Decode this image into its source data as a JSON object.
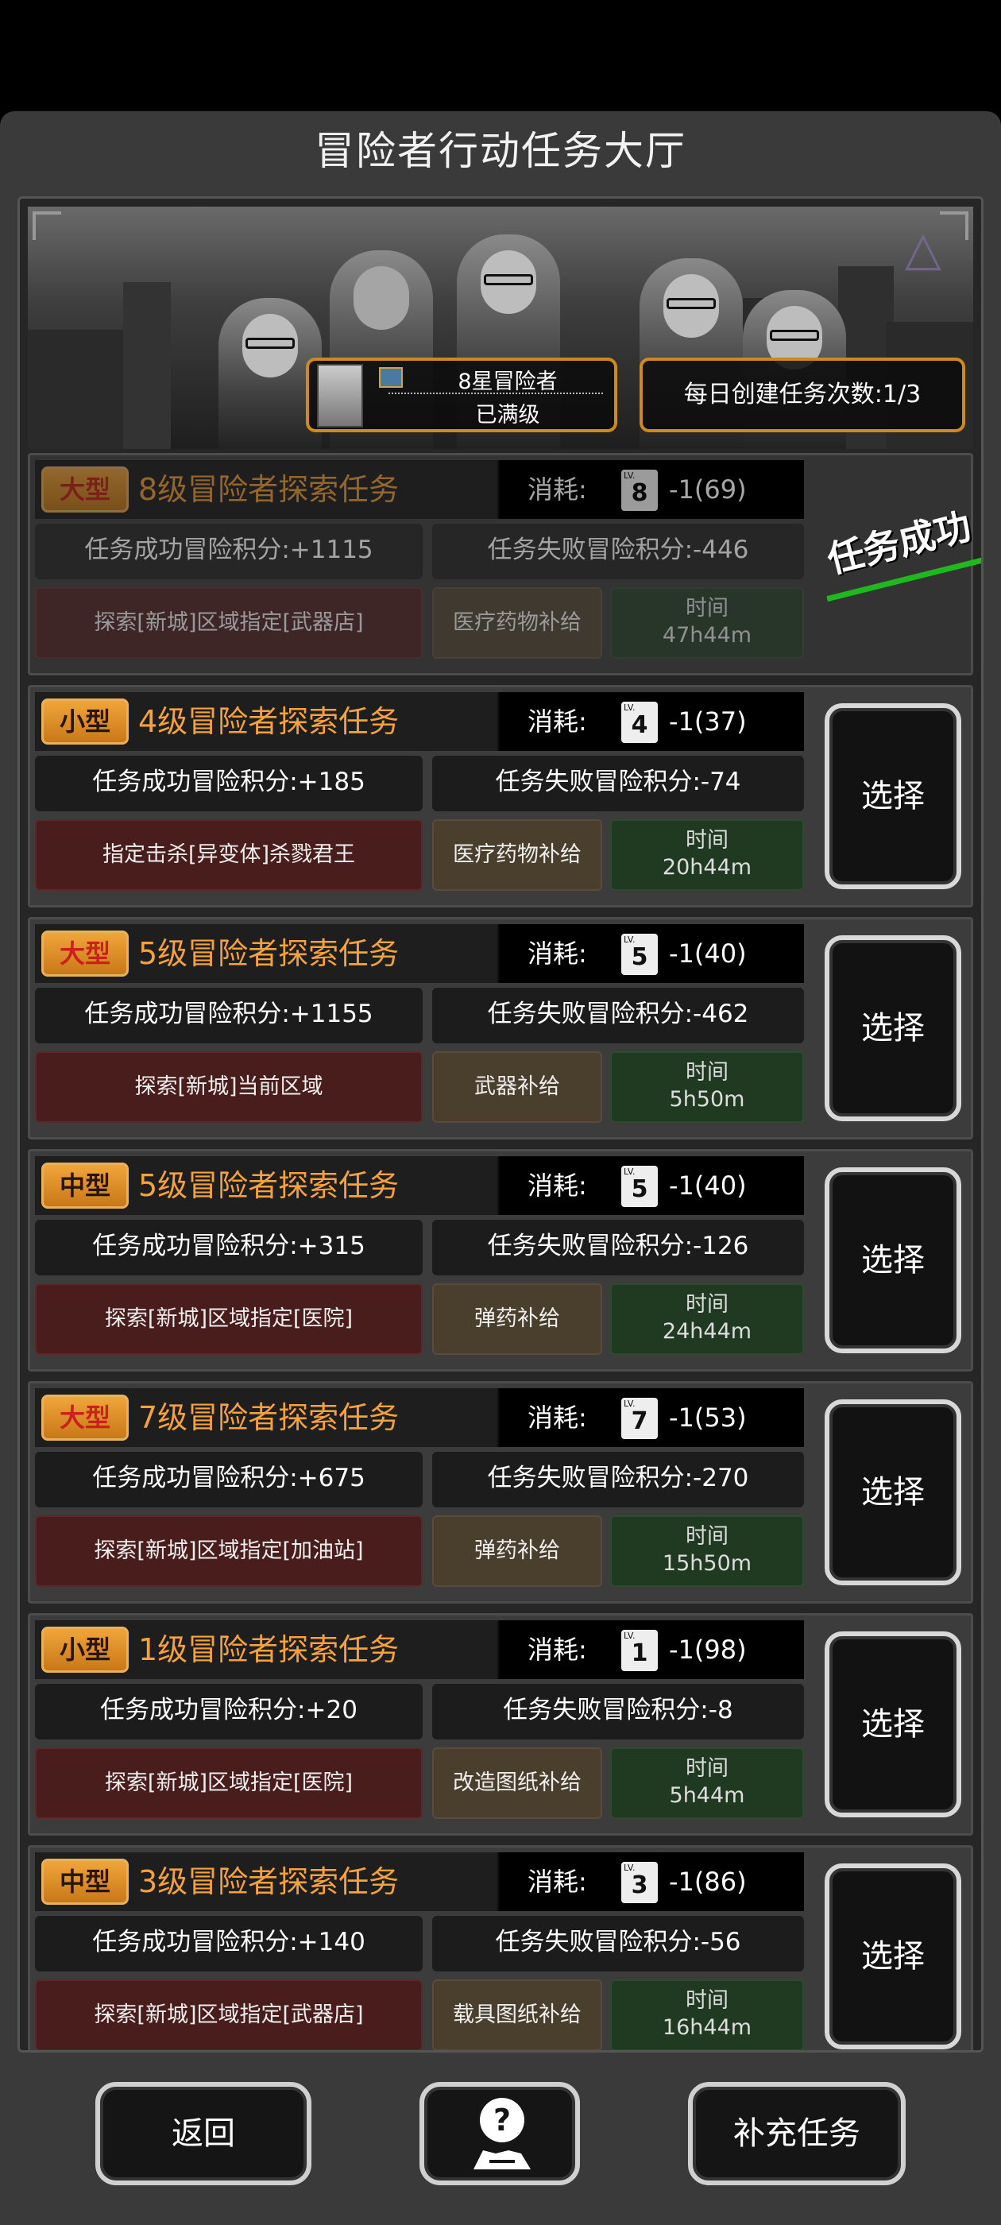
{
  "title": "冒险者行动任务大厅",
  "rank": {
    "title": "8星冒险者",
    "status": "已满级"
  },
  "daily": "每日创建任务次数:1/3",
  "cost_label": "消耗:",
  "choose_label": "选择",
  "stamp_text": "任务成功",
  "missions": [
    {
      "size": "大型",
      "title": "8级冒险者探索任务",
      "lv": "8",
      "cost": "-1(69)",
      "success": "任务成功冒险积分:+1115",
      "fail": "任务失败冒险积分:-446",
      "area": "探索[新城]区域指定[武器店]",
      "supply": "医疗药物补给",
      "time_label": "时间",
      "time": "47h44m",
      "completed": true
    },
    {
      "size": "小型",
      "title": "4级冒险者探索任务",
      "lv": "4",
      "cost": "-1(37)",
      "success": "任务成功冒险积分:+185",
      "fail": "任务失败冒险积分:-74",
      "area": "指定击杀[异变体]杀戮君王",
      "supply": "医疗药物补给",
      "time_label": "时间",
      "time": "20h44m",
      "completed": false
    },
    {
      "size": "大型",
      "title": "5级冒险者探索任务",
      "lv": "5",
      "cost": "-1(40)",
      "success": "任务成功冒险积分:+1155",
      "fail": "任务失败冒险积分:-462",
      "area": "探索[新城]当前区域",
      "supply": "武器补给",
      "time_label": "时间",
      "time": "5h50m",
      "completed": false
    },
    {
      "size": "中型",
      "title": "5级冒险者探索任务",
      "lv": "5",
      "cost": "-1(40)",
      "success": "任务成功冒险积分:+315",
      "fail": "任务失败冒险积分:-126",
      "area": "探索[新城]区域指定[医院]",
      "supply": "弹药补给",
      "time_label": "时间",
      "time": "24h44m",
      "completed": false
    },
    {
      "size": "大型",
      "title": "7级冒险者探索任务",
      "lv": "7",
      "cost": "-1(53)",
      "success": "任务成功冒险积分:+675",
      "fail": "任务失败冒险积分:-270",
      "area": "探索[新城]区域指定[加油站]",
      "supply": "弹药补给",
      "time_label": "时间",
      "time": "15h50m",
      "completed": false
    },
    {
      "size": "小型",
      "title": "1级冒险者探索任务",
      "lv": "1",
      "cost": "-1(98)",
      "success": "任务成功冒险积分:+20",
      "fail": "任务失败冒险积分:-8",
      "area": "探索[新城]区域指定[医院]",
      "supply": "改造图纸补给",
      "time_label": "时间",
      "time": "5h44m",
      "completed": false
    },
    {
      "size": "中型",
      "title": "3级冒险者探索任务",
      "lv": "3",
      "cost": "-1(86)",
      "success": "任务成功冒险积分:+140",
      "fail": "任务失败冒险积分:-56",
      "area": "探索[新城]区域指定[武器店]",
      "supply": "载具图纸补给",
      "time_label": "时间",
      "time": "16h44m",
      "completed": false
    }
  ],
  "buttons": {
    "back": "返回",
    "refill": "补充任务"
  },
  "colors": {
    "accent_orange": "#f5a13c",
    "tag_orange": "#e0902a",
    "danger_red": "#c8221a",
    "success_green": "#1fb81f"
  }
}
